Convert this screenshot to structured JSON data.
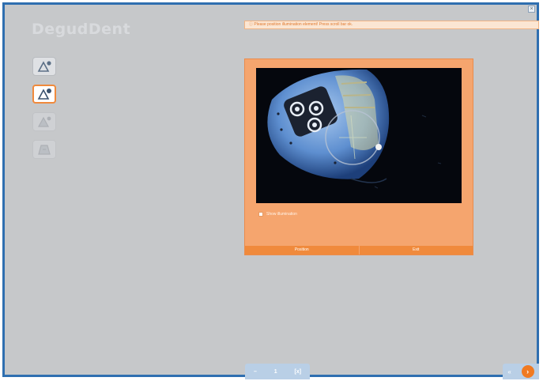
{
  "app": {
    "logo_text": "DegudDent"
  },
  "window": {
    "close_glyph": "×"
  },
  "notice": {
    "text": "Please position illumination element! Press scroll bar ok.",
    "icon": "info-icon"
  },
  "tools": [
    {
      "name": "triangle-add-icon",
      "state": "normal"
    },
    {
      "name": "triangle-active-icon",
      "state": "active"
    },
    {
      "name": "triangle-disabled-icon",
      "state": "disabled"
    },
    {
      "name": "trapezoid-disabled-icon",
      "state": "disabled"
    }
  ],
  "panel": {
    "checkbox_label": "Show illumination",
    "buttons": {
      "left": "Position",
      "right": "Exit"
    }
  },
  "pager": {
    "left_glyph": "–",
    "number": "1",
    "right_glyph": "[x]"
  },
  "nav": {
    "prev_glyph": "«",
    "next_glyph": "›"
  },
  "colors": {
    "accent": "#f08a3c",
    "frame": "#2f6fb0",
    "background": "#c6c8ca"
  }
}
